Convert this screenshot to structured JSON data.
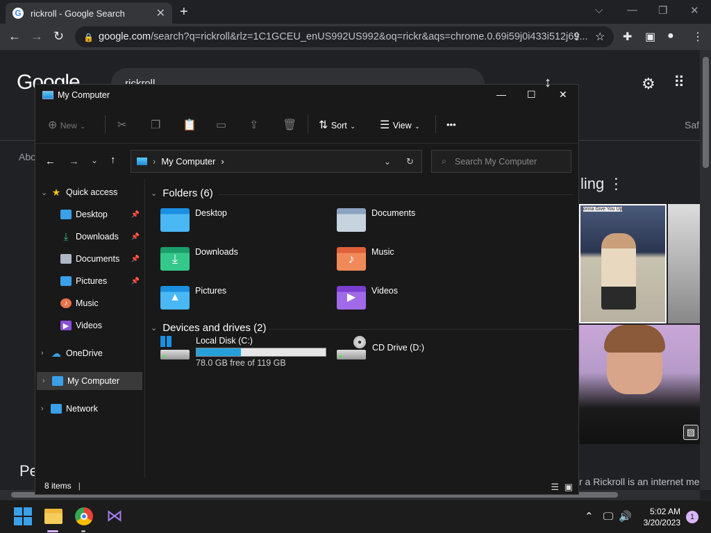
{
  "browser": {
    "tab_title": "rickroll - Google Search",
    "tab_close": "✕",
    "new_tab": "+",
    "url_host": "google.com",
    "url_rest": "/search?q=rickroll&rlz=1C1GCEU_enUS992US992&oq=rickr&aqs=chrome.0.69i59j0i433i512j69..."
  },
  "google": {
    "logo": "Google",
    "query": "rickroll",
    "tab_safe": "Saf",
    "trending": "ling ⋮",
    "image_caption": "onna Give You Up",
    "snippet": "r a Rickroll is an internet me",
    "left_fragment": "Pe",
    "about": "Abo"
  },
  "explorer": {
    "title": "My Computer",
    "cmd": {
      "new": "New",
      "sort": "Sort",
      "view": "View",
      "more": "•••"
    },
    "address": "My Computer",
    "search_placeholder": "Search My Computer",
    "nav": {
      "quick_access": "Quick access",
      "items": [
        "Desktop",
        "Downloads",
        "Documents",
        "Pictures",
        "Music",
        "Videos"
      ],
      "onedrive": "OneDrive",
      "my_computer": "My Computer",
      "network": "Network"
    },
    "folders_header": "Folders (6)",
    "folders": [
      "Desktop",
      "Documents",
      "Downloads",
      "Music",
      "Pictures",
      "Videos"
    ],
    "drives_header": "Devices and drives (2)",
    "drive_c": {
      "name": "Local Disk (C:)",
      "free": "78.0 GB free of 119 GB",
      "used_fraction": 0.345
    },
    "drive_d": {
      "name": "CD Drive (D:)"
    },
    "status": "8 items"
  },
  "taskbar": {
    "time": "5:02 AM",
    "date": "3/20/2023",
    "notifications": "1"
  },
  "colors": {
    "accent": "#26a0da",
    "folder_blue": "#3aa0e8",
    "selected": "#3a3a3a"
  }
}
